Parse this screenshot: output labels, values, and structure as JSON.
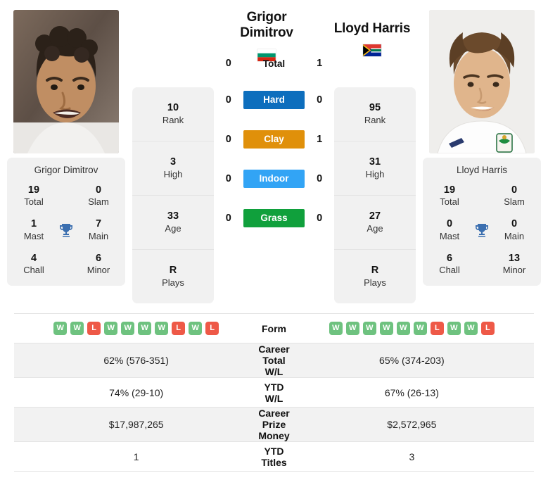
{
  "players": {
    "left": {
      "name_line1": "Grigor",
      "name_line2": "Dimitrov",
      "full_name": "Grigor Dimitrov",
      "country": "Bulgaria",
      "flag_icon": "flag-bulgaria",
      "photo_alt": "Grigor Dimitrov headshot",
      "info": [
        {
          "value": "10",
          "label": "Rank"
        },
        {
          "value": "3",
          "label": "High"
        },
        {
          "value": "33",
          "label": "Age"
        },
        {
          "value": "R",
          "label": "Plays"
        }
      ],
      "titles": [
        {
          "left_value": "19",
          "left_label": "Total",
          "right_value": "0",
          "right_label": "Slam"
        },
        {
          "left_value": "1",
          "left_label": "Mast",
          "right_value": "7",
          "right_label": "Main"
        },
        {
          "left_value": "4",
          "left_label": "Chall",
          "right_value": "6",
          "right_label": "Minor"
        }
      ],
      "form": [
        "W",
        "W",
        "L",
        "W",
        "W",
        "W",
        "W",
        "L",
        "W",
        "L"
      ],
      "career_total_wl": "62% (576-351)",
      "ytd_wl": "74% (29-10)",
      "career_prize_money": "$17,987,265",
      "ytd_titles": "1"
    },
    "right": {
      "name_line1": "Lloyd Harris",
      "name_line2": "",
      "full_name": "Lloyd Harris",
      "country": "South Africa",
      "flag_icon": "flag-south-africa",
      "photo_alt": "Lloyd Harris headshot",
      "info": [
        {
          "value": "95",
          "label": "Rank"
        },
        {
          "value": "31",
          "label": "High"
        },
        {
          "value": "27",
          "label": "Age"
        },
        {
          "value": "R",
          "label": "Plays"
        }
      ],
      "titles": [
        {
          "left_value": "19",
          "left_label": "Total",
          "right_value": "0",
          "right_label": "Slam"
        },
        {
          "left_value": "0",
          "left_label": "Mast",
          "right_value": "0",
          "right_label": "Main"
        },
        {
          "left_value": "6",
          "left_label": "Chall",
          "right_value": "13",
          "right_label": "Minor"
        }
      ],
      "form": [
        "W",
        "W",
        "W",
        "W",
        "W",
        "W",
        "L",
        "W",
        "W",
        "L"
      ],
      "career_total_wl": "65% (374-203)",
      "ytd_wl": "67% (26-13)",
      "career_prize_money": "$2,572,965",
      "ytd_titles": "3"
    }
  },
  "head_to_head": {
    "total": {
      "label": "Total",
      "left": "0",
      "right": "1"
    },
    "surfaces": [
      {
        "label": "Hard",
        "left": "0",
        "right": "0",
        "color": "#0d6ebd"
      },
      {
        "label": "Clay",
        "left": "0",
        "right": "1",
        "color": "#e0900a"
      },
      {
        "label": "Indoor",
        "left": "0",
        "right": "0",
        "color": "#32a4f5"
      },
      {
        "label": "Grass",
        "left": "0",
        "right": "0",
        "color": "#10a03c"
      }
    ]
  },
  "table": {
    "rows": [
      {
        "label": "Form",
        "type": "form"
      },
      {
        "label": "Career Total W/L",
        "type": "text",
        "key": "career_total_wl"
      },
      {
        "label": "YTD W/L",
        "type": "text",
        "key": "ytd_wl"
      },
      {
        "label": "Career Prize Money",
        "type": "text",
        "key": "career_prize_money"
      },
      {
        "label": "YTD Titles",
        "type": "text",
        "key": "ytd_titles"
      }
    ]
  },
  "colors": {
    "win": "#6ec27f",
    "loss": "#ee5947",
    "trophy": "#3b6fb0",
    "card_bg": "#f1f1f1",
    "row_alt": "#f2f2f2"
  },
  "icons": {
    "trophy": "trophy-icon"
  }
}
